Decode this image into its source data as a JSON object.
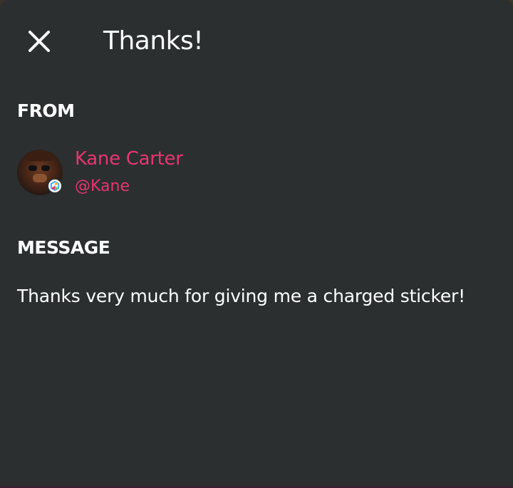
{
  "header": {
    "title": "Thanks!",
    "close_icon": "close-icon"
  },
  "from_section": {
    "label": "FROM",
    "sender": {
      "name": "Kane Carter",
      "handle": "@Kane",
      "avatar_icon": "avatar",
      "badge_icon": "hexagon-badge-icon"
    }
  },
  "message_section": {
    "label": "MESSAGE",
    "text": "Thanks very much for giving me a charged sticker!"
  },
  "colors": {
    "background": "#2b2f2f",
    "accent": "#e8356f",
    "text": "#ffffff"
  }
}
